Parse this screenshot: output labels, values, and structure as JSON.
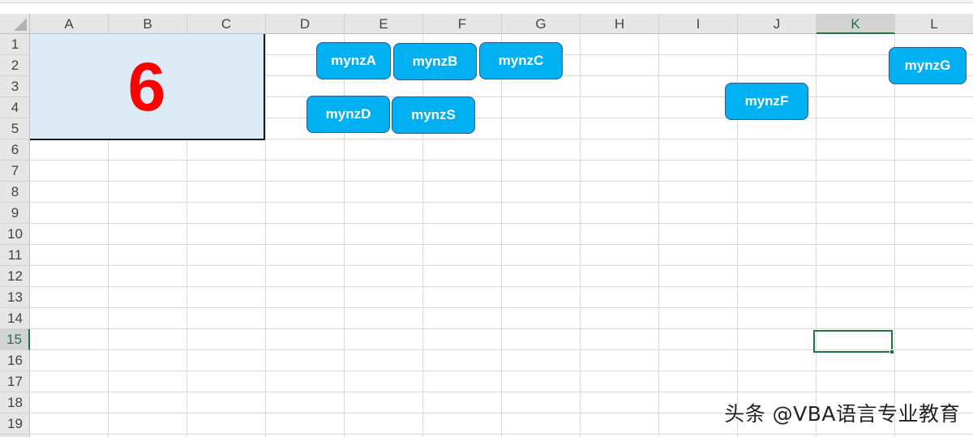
{
  "columns": [
    "A",
    "B",
    "C",
    "D",
    "E",
    "F",
    "G",
    "H",
    "I",
    "J",
    "K",
    "L"
  ],
  "rows": [
    "1",
    "2",
    "3",
    "4",
    "5",
    "6",
    "7",
    "8",
    "9",
    "10",
    "11",
    "12",
    "13",
    "14",
    "15",
    "16",
    "17",
    "18",
    "19"
  ],
  "active_column": "K",
  "active_row": "15",
  "merged_cell": {
    "value": "6",
    "text_color": "#ff0000",
    "fill_color": "#ddebf7"
  },
  "buttons": {
    "mynzA": "mynzA",
    "mynzB": "mynzB",
    "mynzC": "mynzC",
    "mynzD": "mynzD",
    "mynzS": "mynzS",
    "mynzF": "mynzF",
    "mynzG": "mynzG"
  },
  "button_color": "#00b0f0",
  "accent_color": "#217346",
  "watermark": "头条 @VBA语言专业教育"
}
